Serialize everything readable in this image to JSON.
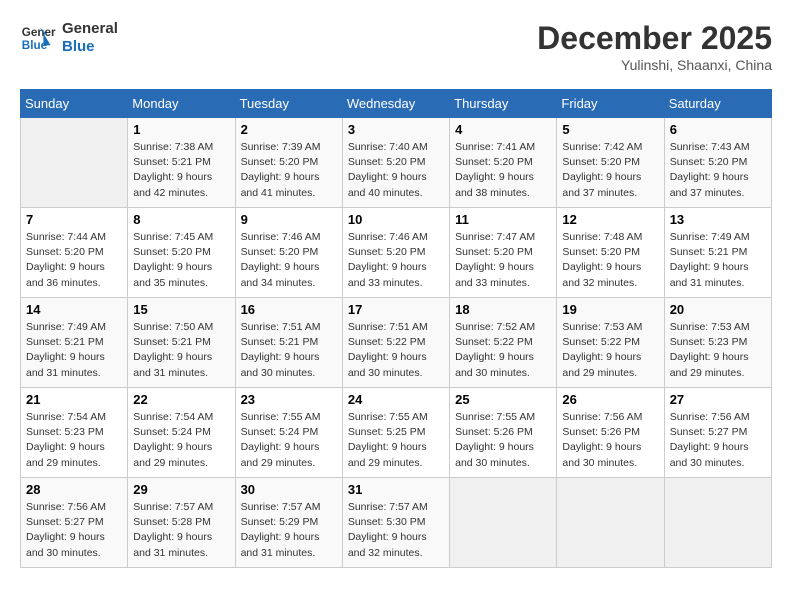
{
  "header": {
    "logo_line1": "General",
    "logo_line2": "Blue",
    "month": "December 2025",
    "location": "Yulinshi, Shaanxi, China"
  },
  "days_of_week": [
    "Sunday",
    "Monday",
    "Tuesday",
    "Wednesday",
    "Thursday",
    "Friday",
    "Saturday"
  ],
  "weeks": [
    [
      {
        "day": "",
        "info": ""
      },
      {
        "day": "1",
        "info": "Sunrise: 7:38 AM\nSunset: 5:21 PM\nDaylight: 9 hours\nand 42 minutes."
      },
      {
        "day": "2",
        "info": "Sunrise: 7:39 AM\nSunset: 5:20 PM\nDaylight: 9 hours\nand 41 minutes."
      },
      {
        "day": "3",
        "info": "Sunrise: 7:40 AM\nSunset: 5:20 PM\nDaylight: 9 hours\nand 40 minutes."
      },
      {
        "day": "4",
        "info": "Sunrise: 7:41 AM\nSunset: 5:20 PM\nDaylight: 9 hours\nand 38 minutes."
      },
      {
        "day": "5",
        "info": "Sunrise: 7:42 AM\nSunset: 5:20 PM\nDaylight: 9 hours\nand 37 minutes."
      },
      {
        "day": "6",
        "info": "Sunrise: 7:43 AM\nSunset: 5:20 PM\nDaylight: 9 hours\nand 37 minutes."
      }
    ],
    [
      {
        "day": "7",
        "info": "Sunrise: 7:44 AM\nSunset: 5:20 PM\nDaylight: 9 hours\nand 36 minutes."
      },
      {
        "day": "8",
        "info": "Sunrise: 7:45 AM\nSunset: 5:20 PM\nDaylight: 9 hours\nand 35 minutes."
      },
      {
        "day": "9",
        "info": "Sunrise: 7:46 AM\nSunset: 5:20 PM\nDaylight: 9 hours\nand 34 minutes."
      },
      {
        "day": "10",
        "info": "Sunrise: 7:46 AM\nSunset: 5:20 PM\nDaylight: 9 hours\nand 33 minutes."
      },
      {
        "day": "11",
        "info": "Sunrise: 7:47 AM\nSunset: 5:20 PM\nDaylight: 9 hours\nand 33 minutes."
      },
      {
        "day": "12",
        "info": "Sunrise: 7:48 AM\nSunset: 5:20 PM\nDaylight: 9 hours\nand 32 minutes."
      },
      {
        "day": "13",
        "info": "Sunrise: 7:49 AM\nSunset: 5:21 PM\nDaylight: 9 hours\nand 31 minutes."
      }
    ],
    [
      {
        "day": "14",
        "info": "Sunrise: 7:49 AM\nSunset: 5:21 PM\nDaylight: 9 hours\nand 31 minutes."
      },
      {
        "day": "15",
        "info": "Sunrise: 7:50 AM\nSunset: 5:21 PM\nDaylight: 9 hours\nand 31 minutes."
      },
      {
        "day": "16",
        "info": "Sunrise: 7:51 AM\nSunset: 5:21 PM\nDaylight: 9 hours\nand 30 minutes."
      },
      {
        "day": "17",
        "info": "Sunrise: 7:51 AM\nSunset: 5:22 PM\nDaylight: 9 hours\nand 30 minutes."
      },
      {
        "day": "18",
        "info": "Sunrise: 7:52 AM\nSunset: 5:22 PM\nDaylight: 9 hours\nand 30 minutes."
      },
      {
        "day": "19",
        "info": "Sunrise: 7:53 AM\nSunset: 5:22 PM\nDaylight: 9 hours\nand 29 minutes."
      },
      {
        "day": "20",
        "info": "Sunrise: 7:53 AM\nSunset: 5:23 PM\nDaylight: 9 hours\nand 29 minutes."
      }
    ],
    [
      {
        "day": "21",
        "info": "Sunrise: 7:54 AM\nSunset: 5:23 PM\nDaylight: 9 hours\nand 29 minutes."
      },
      {
        "day": "22",
        "info": "Sunrise: 7:54 AM\nSunset: 5:24 PM\nDaylight: 9 hours\nand 29 minutes."
      },
      {
        "day": "23",
        "info": "Sunrise: 7:55 AM\nSunset: 5:24 PM\nDaylight: 9 hours\nand 29 minutes."
      },
      {
        "day": "24",
        "info": "Sunrise: 7:55 AM\nSunset: 5:25 PM\nDaylight: 9 hours\nand 29 minutes."
      },
      {
        "day": "25",
        "info": "Sunrise: 7:55 AM\nSunset: 5:26 PM\nDaylight: 9 hours\nand 30 minutes."
      },
      {
        "day": "26",
        "info": "Sunrise: 7:56 AM\nSunset: 5:26 PM\nDaylight: 9 hours\nand 30 minutes."
      },
      {
        "day": "27",
        "info": "Sunrise: 7:56 AM\nSunset: 5:27 PM\nDaylight: 9 hours\nand 30 minutes."
      }
    ],
    [
      {
        "day": "28",
        "info": "Sunrise: 7:56 AM\nSunset: 5:27 PM\nDaylight: 9 hours\nand 30 minutes."
      },
      {
        "day": "29",
        "info": "Sunrise: 7:57 AM\nSunset: 5:28 PM\nDaylight: 9 hours\nand 31 minutes."
      },
      {
        "day": "30",
        "info": "Sunrise: 7:57 AM\nSunset: 5:29 PM\nDaylight: 9 hours\nand 31 minutes."
      },
      {
        "day": "31",
        "info": "Sunrise: 7:57 AM\nSunset: 5:30 PM\nDaylight: 9 hours\nand 32 minutes."
      },
      {
        "day": "",
        "info": ""
      },
      {
        "day": "",
        "info": ""
      },
      {
        "day": "",
        "info": ""
      }
    ]
  ]
}
